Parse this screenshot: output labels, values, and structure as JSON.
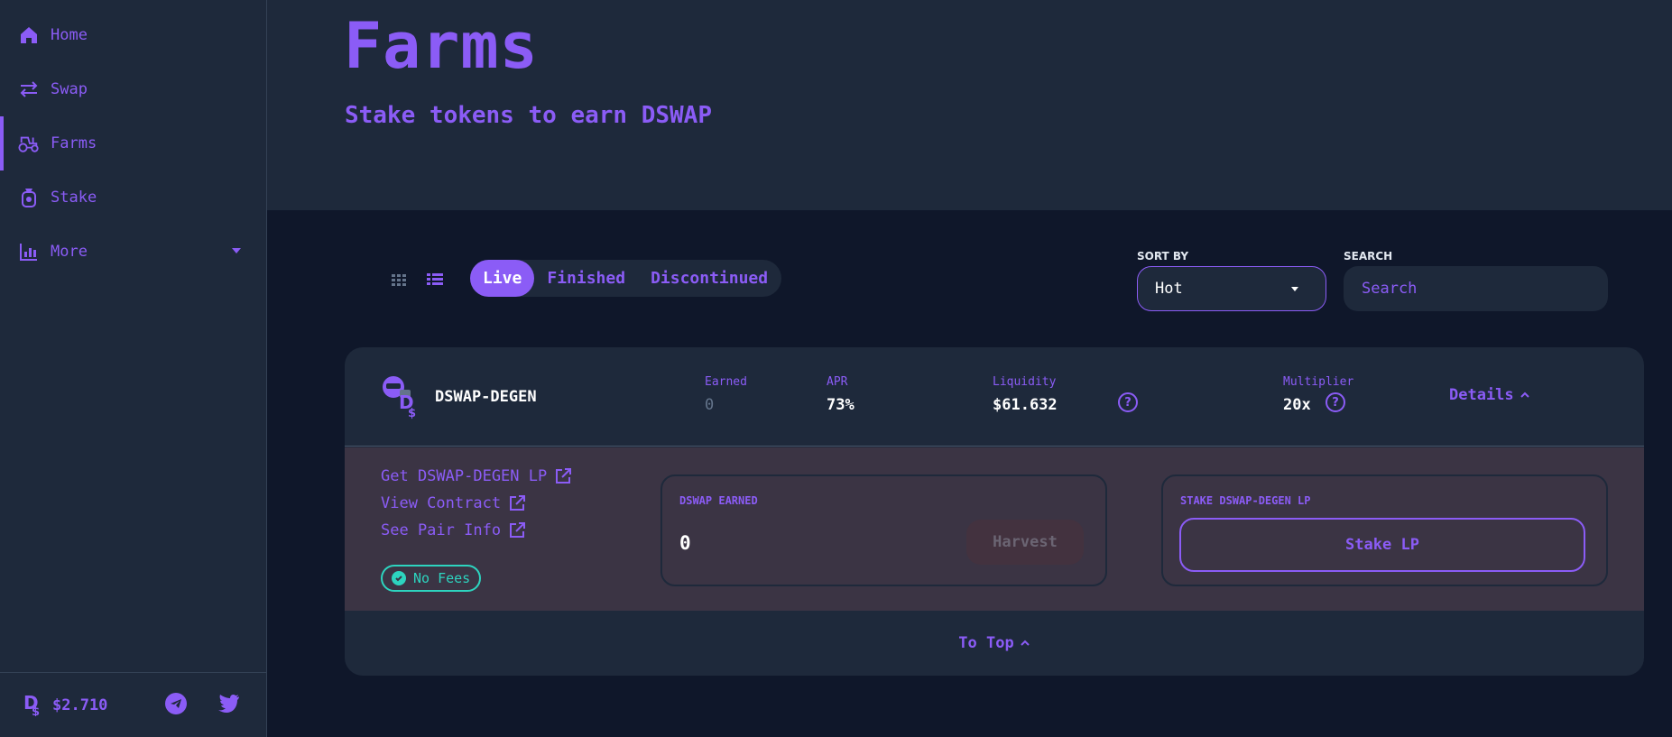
{
  "sidebar": {
    "items": [
      {
        "label": "Home",
        "icon": "home-icon"
      },
      {
        "label": "Swap",
        "icon": "swap-icon"
      },
      {
        "label": "Farms",
        "icon": "tractor-icon"
      },
      {
        "label": "Stake",
        "icon": "pot-icon"
      },
      {
        "label": "More",
        "icon": "chart-icon"
      }
    ],
    "active": "Farms",
    "footer": {
      "price": "$2.710"
    }
  },
  "header": {
    "title": "Farms",
    "subtitle": "Stake tokens to earn DSWAP"
  },
  "controls": {
    "tabs": [
      "Live",
      "Finished",
      "Discontinued"
    ],
    "active_tab": "Live",
    "sort_label": "SORT BY",
    "sort_value": "Hot",
    "search_label": "SEARCH",
    "search_placeholder": "Search"
  },
  "farm": {
    "name": "DSWAP-DEGEN",
    "earned_label": "Earned",
    "earned_value": "0",
    "apr_label": "APR",
    "apr_value": "73%",
    "liquidity_label": "Liquidity",
    "liquidity_value": "$61.632",
    "multiplier_label": "Multiplier",
    "multiplier_value": "20x",
    "details_label": "Details",
    "links": [
      "Get DSWAP-DEGEN LP",
      "View Contract",
      "See Pair Info"
    ],
    "badge": "No Fees",
    "earned_panel_label": "DSWAP EARNED",
    "earned_panel_value": "0",
    "harvest_label": "Harvest",
    "stake_panel_label": "STAKE DSWAP-DEGEN LP",
    "stake_button": "Stake LP",
    "to_top": "To Top"
  },
  "colors": {
    "accent": "#8b5cf6",
    "background": "#0f172a",
    "surface": "#1e293b",
    "success": "#2dd4bf"
  }
}
